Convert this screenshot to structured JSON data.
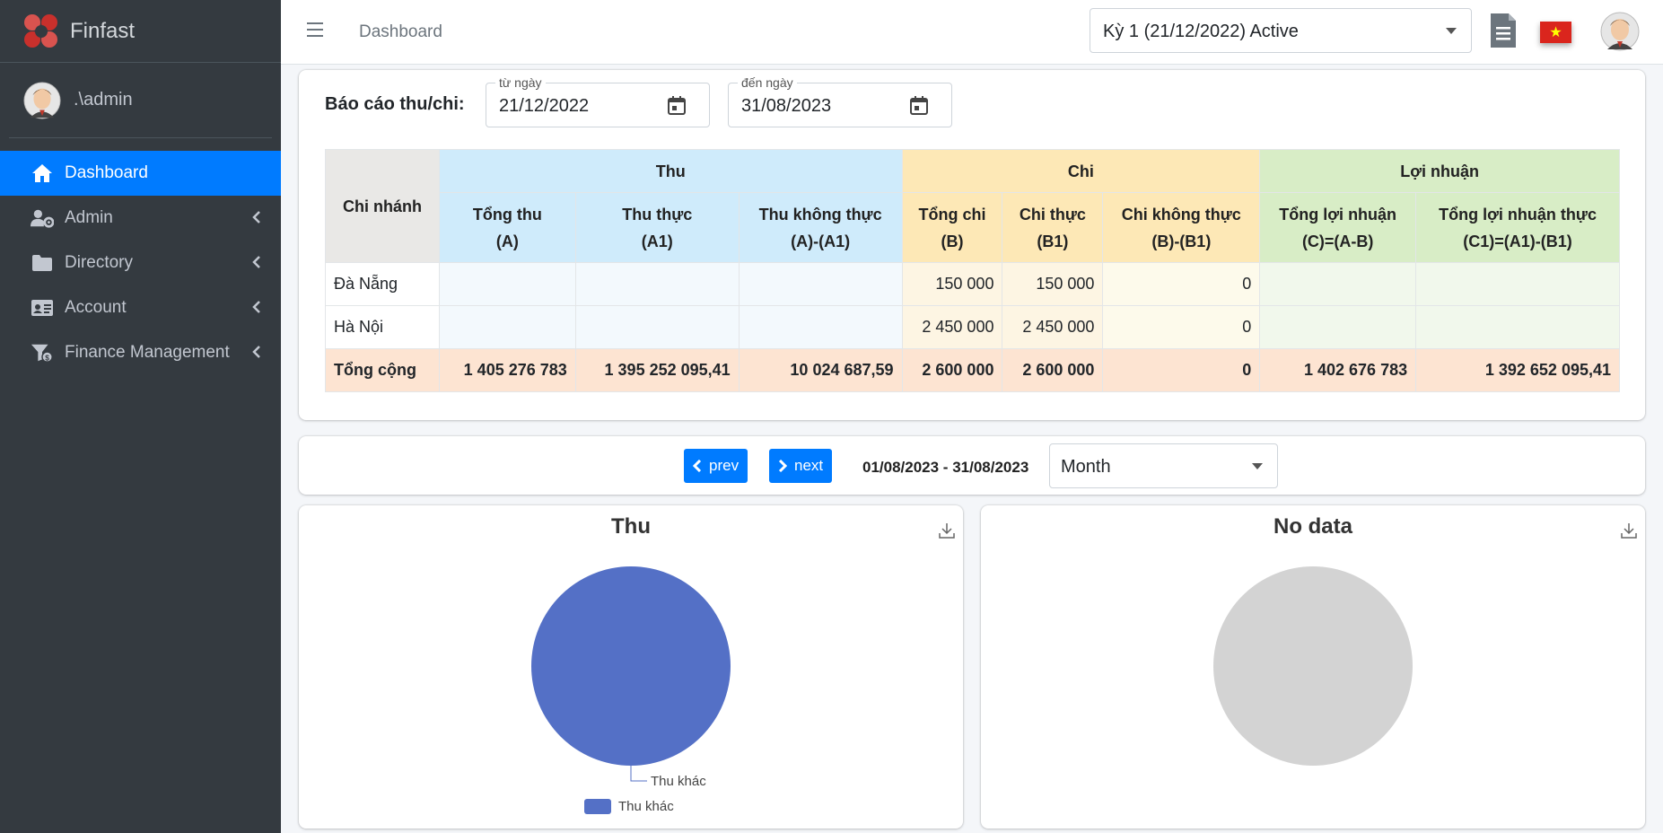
{
  "brand": {
    "name": "Finfast"
  },
  "user": {
    "name": ".\\admin"
  },
  "sidebar": {
    "items": [
      {
        "label": "Dashboard",
        "icon": "home-icon",
        "active": true
      },
      {
        "label": "Admin",
        "icon": "user-gear-icon"
      },
      {
        "label": "Directory",
        "icon": "folder-icon"
      },
      {
        "label": "Account",
        "icon": "id-card-icon"
      },
      {
        "label": "Finance Management",
        "icon": "funnel-dollar-icon"
      }
    ]
  },
  "header": {
    "breadcrumb": "Dashboard",
    "period": "Kỳ 1 (21/12/2022) Active",
    "flag_star": "★"
  },
  "report": {
    "title": "Báo cáo thu/chi:",
    "from_label": "từ ngày",
    "from_value": "21/12/2022",
    "to_label": "đến ngày",
    "to_value": "31/08/2023",
    "group_headers": {
      "branch": "Chi nhánh",
      "thu": "Thu",
      "chi": "Chi",
      "loi": "Lợi nhuận"
    },
    "columns": [
      [
        "Tổng thu",
        "(A)"
      ],
      [
        "Thu thực",
        "(A1)"
      ],
      [
        "Thu không thực",
        "(A)-(A1)"
      ],
      [
        "Tổng chi",
        "(B)"
      ],
      [
        "Chi thực",
        "(B1)"
      ],
      [
        "Chi không thực",
        "(B)-(B1)"
      ],
      [
        "Tổng lợi nhuận",
        "(C)=(A-B)"
      ],
      [
        "Tổng lợi nhuận thực",
        "(C1)=(A1)-(B1)"
      ]
    ],
    "rows": [
      {
        "branch": "Đà Nẵng",
        "cells": [
          "",
          "",
          "",
          "150 000",
          "150 000",
          "0",
          "",
          ""
        ]
      },
      {
        "branch": "Hà Nội",
        "cells": [
          "",
          "",
          "",
          "2 450 000",
          "2 450 000",
          "0",
          "",
          ""
        ]
      }
    ],
    "total": {
      "label": "Tổng cộng",
      "cells": [
        "1 405 276 783",
        "1 395 252 095,41",
        "10 024 687,59",
        "2 600 000",
        "2 600 000",
        "0",
        "1 402 676 783",
        "1 392 652 095,41"
      ]
    }
  },
  "nav": {
    "prev_label": "prev",
    "next_label": "next",
    "range": "01/08/2023 - 31/08/2023",
    "mode": "Month"
  },
  "chart_data": [
    {
      "type": "pie",
      "title": "Thu",
      "categories": [
        "Thu khác"
      ],
      "values": [
        100
      ],
      "colors": [
        "#5470c6"
      ],
      "legend": "bottom-center",
      "slice_labels": [
        "Thu khác"
      ]
    },
    {
      "type": "pie",
      "title": "No data",
      "categories": [],
      "values": [],
      "colors": [
        "#d3d3d3"
      ]
    }
  ]
}
